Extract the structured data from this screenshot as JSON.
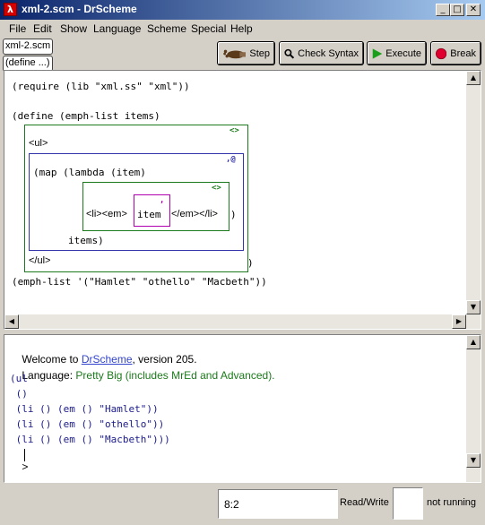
{
  "window": {
    "title": "xml-2.scm - DrScheme",
    "app_icon_glyph": "λ",
    "controls": {
      "minimize": "_",
      "maximize": "□",
      "close": "✕"
    }
  },
  "menu": [
    "File",
    "Edit",
    "Show",
    "Language",
    "Scheme",
    "Special",
    "Help"
  ],
  "toolbar": {
    "file_chip": "xml-2.scm",
    "define_chip": "(define ...)",
    "step_label": "Step",
    "check_syntax_label": "Check Syntax",
    "execute_label": "Execute",
    "break_label": "Break",
    "colors": {
      "execute": "#1b9e1b",
      "break": "#e00030"
    }
  },
  "definitions": {
    "line1": "(require (lib \"xml.ss\" \"xml\"))",
    "line2": "(define (emph-list items)",
    "outer_snip_label": "<>",
    "ul_open": "<ul>",
    "unquote_label": ",@",
    "map_line": "(map (lambda (item)",
    "inner_snip_label": "<>",
    "li_em_open": "<li><em>",
    "unquote_comma": ",",
    "item_code": "item",
    "em_li_close": "</em></li>",
    "map_close_paren": ")",
    "items_line": "items)",
    "ul_close": "</ul>",
    "outer_close_paren": ")",
    "call_line": "(emph-list '(\"Hamlet\" \"othello\" \"Macbeth\"))"
  },
  "interactions": {
    "welcome_prefix": "Welcome to ",
    "welcome_link": "DrScheme",
    "welcome_suffix": ", version 205.",
    "language_prefix": "Language: ",
    "language_value": "Pretty Big (includes MrEd and Advanced).",
    "output": [
      "(ul",
      " ()",
      " (li () (em () \"Hamlet\"))",
      " (li () (em () \"othello\"))",
      " (li () (em () \"Macbeth\")))"
    ],
    "prompt": ">",
    "colors": {
      "link": "#3344cc",
      "language": "#1b7a1b",
      "output": "#1a1a8c"
    }
  },
  "status": {
    "position": "8:2",
    "mode": "Read/Write",
    "state": "not running"
  },
  "scroll_glyphs": {
    "up": "▲",
    "down": "▼",
    "left": "◀",
    "right": "▶"
  }
}
